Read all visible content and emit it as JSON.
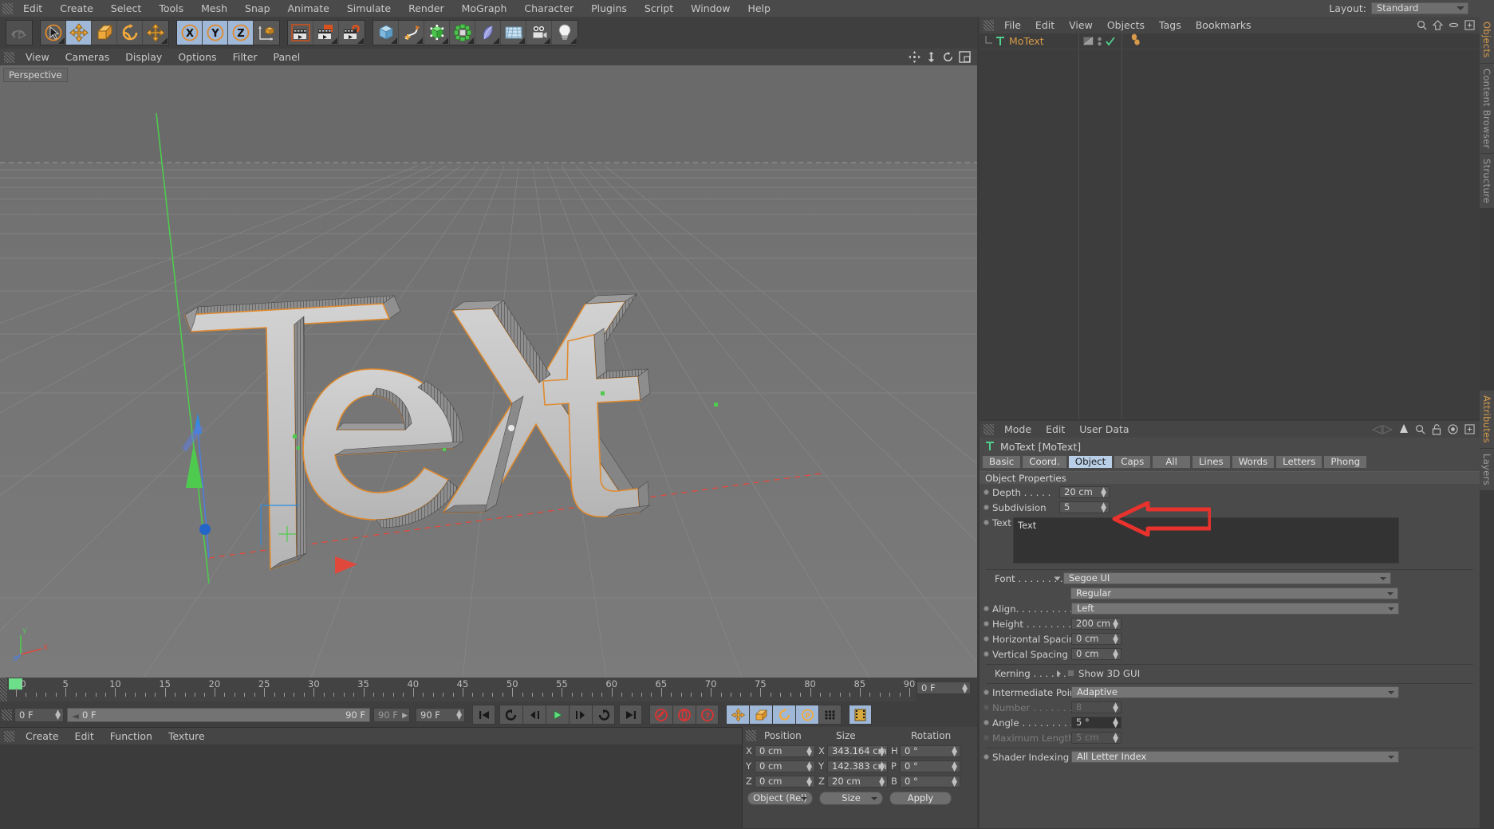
{
  "app": {
    "menu": [
      "Edit",
      "Create",
      "Select",
      "Tools",
      "Mesh",
      "Snap",
      "Animate",
      "Simulate",
      "Render",
      "MoGraph",
      "Character",
      "Plugins",
      "Script",
      "Window",
      "Help"
    ],
    "layout_label": "Layout:",
    "layout_value": "Standard"
  },
  "toolbar": {
    "groups": [
      {
        "name": "undo",
        "buttons": [
          {
            "icon": "undo-redo-icon",
            "label": "Undo/Redo",
            "state": "disabled"
          }
        ]
      },
      {
        "name": "transform",
        "buttons": [
          {
            "icon": "live-selection-icon",
            "label": "Live Selection",
            "state": "normal"
          },
          {
            "icon": "move-icon",
            "label": "Move",
            "state": "selected"
          },
          {
            "icon": "scale-icon",
            "label": "Scale",
            "state": "normal"
          },
          {
            "icon": "rotate-icon",
            "label": "Rotate",
            "state": "normal"
          },
          {
            "icon": "move-alt-icon",
            "label": "Move Tool",
            "state": "normal"
          }
        ]
      },
      {
        "name": "axis-lock",
        "buttons": [
          {
            "icon": "x-axis-icon",
            "label": "X Axis",
            "state": "selected"
          },
          {
            "icon": "y-axis-icon",
            "label": "Y Axis",
            "state": "selected"
          },
          {
            "icon": "z-axis-icon",
            "label": "Z Axis",
            "state": "selected"
          },
          {
            "icon": "world-object-axis-icon",
            "label": "World/Object Coordinate",
            "state": "normal"
          }
        ]
      },
      {
        "name": "render",
        "buttons": [
          {
            "icon": "render-view-icon",
            "label": "Render View",
            "state": "normal"
          },
          {
            "icon": "render-region-icon",
            "label": "Render to Picture Viewer",
            "state": "normal"
          },
          {
            "icon": "render-settings-icon",
            "label": "Edit Render Settings",
            "state": "normal"
          }
        ]
      },
      {
        "name": "objects",
        "buttons": [
          {
            "icon": "cube-primitive-icon",
            "label": "Add Cube Object",
            "state": "normal"
          },
          {
            "icon": "spline-pen-icon",
            "label": "Add Spline",
            "state": "normal"
          },
          {
            "icon": "generator-icon",
            "label": "Generators",
            "state": "normal"
          },
          {
            "icon": "array-icon",
            "label": "Modeling Objects",
            "state": "normal"
          },
          {
            "icon": "deformer-icon",
            "label": "Deformers",
            "state": "normal"
          },
          {
            "icon": "scene-environment-icon",
            "label": "Scene Objects",
            "state": "normal"
          },
          {
            "icon": "camera-icon",
            "label": "Add Camera",
            "state": "normal"
          },
          {
            "icon": "light-icon",
            "label": "Add Light",
            "state": "normal"
          }
        ]
      }
    ]
  },
  "viewport": {
    "menu": [
      "View",
      "Cameras",
      "Display",
      "Options",
      "Filter",
      "Panel"
    ],
    "view_label": "Perspective",
    "corner_icons": [
      "pan-icon",
      "dolly-icon",
      "rotate-view-icon",
      "maximize-view-icon"
    ],
    "axis_gizmo": {
      "y": "Y",
      "x": "X",
      "z": "Z"
    },
    "scene_text": "Text"
  },
  "timeline": {
    "ticks": [
      {
        "label": "0",
        "frame": 0
      },
      {
        "label": "5",
        "frame": 5
      },
      {
        "label": "10",
        "frame": 10
      },
      {
        "label": "15",
        "frame": 15
      },
      {
        "label": "20",
        "frame": 20
      },
      {
        "label": "25",
        "frame": 25
      },
      {
        "label": "30",
        "frame": 30
      },
      {
        "label": "35",
        "frame": 35
      },
      {
        "label": "40",
        "frame": 40
      },
      {
        "label": "45",
        "frame": 45
      },
      {
        "label": "50",
        "frame": 50
      },
      {
        "label": "55",
        "frame": 55
      },
      {
        "label": "60",
        "frame": 60
      },
      {
        "label": "65",
        "frame": 65
      },
      {
        "label": "70",
        "frame": 70
      },
      {
        "label": "75",
        "frame": 75
      },
      {
        "label": "80",
        "frame": 80
      },
      {
        "label": "85",
        "frame": 85
      },
      {
        "label": "90",
        "frame": 90
      }
    ],
    "range_min": 0,
    "range_max": 90,
    "current_frame_field": "0 F",
    "start_frame": "0 F",
    "slider_start": "0 F",
    "slider_end": "90 F",
    "end_frame_small": "90 F",
    "end_frame_field": "90 F",
    "transport_buttons": [
      {
        "icon": "go-to-start-icon",
        "label": "Go to Start"
      },
      {
        "icon": "step-back-keyframe-icon",
        "label": "Go to Previous Key"
      },
      {
        "icon": "step-back-icon",
        "label": "Go to Previous Frame"
      },
      {
        "icon": "play-icon",
        "label": "Play Forwards"
      },
      {
        "icon": "step-forward-icon",
        "label": "Go to Next Frame"
      },
      {
        "icon": "step-forward-keyframe-icon",
        "label": "Go to Next Key"
      },
      {
        "icon": "go-to-end-icon",
        "label": "Go to End"
      }
    ],
    "record_buttons": [
      {
        "icon": "record-key-icon",
        "label": "Record Active Objects"
      },
      {
        "icon": "autokey-icon",
        "label": "Autokeying"
      },
      {
        "icon": "keyframe-selection-icon",
        "label": "Keyframe Selection"
      }
    ],
    "key_toggles": [
      {
        "icon": "position-key-icon",
        "label": "Position",
        "state": "selected"
      },
      {
        "icon": "scale-key-icon",
        "label": "Scale",
        "state": "selected"
      },
      {
        "icon": "rotation-key-icon",
        "label": "Rotation",
        "state": "selected"
      },
      {
        "icon": "param-key-icon",
        "label": "Parameter",
        "state": "selected"
      },
      {
        "icon": "point-level-key-icon",
        "label": "Point Level Animation",
        "state": "normal"
      }
    ],
    "extra_buttons": [
      {
        "icon": "filmstrip-icon",
        "label": "Animation Mode",
        "state": "selected"
      }
    ]
  },
  "material_manager": {
    "menu": [
      "Create",
      "Edit",
      "Function",
      "Texture"
    ]
  },
  "coordinates": {
    "headers": [
      "Position",
      "Size",
      "Rotation"
    ],
    "rows": [
      {
        "pos_axis": "X",
        "pos": "0 cm",
        "size_axis": "X",
        "size": "343.164 cm",
        "rot_axis": "H",
        "rot": "0 °"
      },
      {
        "pos_axis": "Y",
        "pos": "0 cm",
        "size_axis": "Y",
        "size": "142.383 cm",
        "rot_axis": "P",
        "rot": "0 °"
      },
      {
        "pos_axis": "Z",
        "pos": "0 cm",
        "size_axis": "Z",
        "size": "20 cm",
        "rot_axis": "B",
        "rot": "0 °"
      }
    ],
    "mode_dropdown": "Object (Rel)",
    "size_dropdown": "Size",
    "apply_button": "Apply"
  },
  "object_manager": {
    "menu": [
      "File",
      "Edit",
      "View",
      "Objects",
      "Tags",
      "Bookmarks"
    ],
    "icons": [
      "search-icon",
      "home-icon",
      "ellipse-icon",
      "add-panel-icon"
    ],
    "items": [
      {
        "name": "MoText",
        "type_icon": "text-object-icon",
        "tags": [
          "mograph-tag-icon"
        ],
        "visible_dots": "on"
      }
    ]
  },
  "attributes": {
    "menu": [
      "Mode",
      "Edit",
      "User Data"
    ],
    "icons": [
      "nav-arrows-icon",
      "pin-icon",
      "search-icon",
      "lock-icon",
      "target-icon",
      "add-panel-icon"
    ],
    "object_title": "MoText [MoText]",
    "tabs": [
      {
        "label": "Basic",
        "active": false
      },
      {
        "label": "Coord.",
        "active": false
      },
      {
        "label": "Object",
        "active": true
      },
      {
        "label": "Caps",
        "active": false
      },
      {
        "label": "All",
        "active": false
      },
      {
        "label": "Lines",
        "active": false
      },
      {
        "label": "Words",
        "active": false
      },
      {
        "label": "Letters",
        "active": false
      },
      {
        "label": "Phong",
        "active": false
      }
    ],
    "section_title": "Object Properties",
    "fields": {
      "depth_label": "Depth . . . . .",
      "depth_value": "20 cm",
      "subdivision_label": "Subdivision",
      "subdivision_value": "5",
      "text_label": "Text",
      "text_value": "Text",
      "font_label": "Font . . . . . . . . . .",
      "font_value": "Segoe UI",
      "font_style_value": "Regular",
      "align_label": "Align. . . . . . . . . . .",
      "align_value": "Left",
      "height_label": "Height . . . . . . . . .",
      "height_value": "200 cm",
      "hspacing_label": "Horizontal Spacing",
      "hspacing_value": "0 cm",
      "vspacing_label": "Vertical Spacing . .",
      "vspacing_value": "0 cm",
      "kerning_label": "Kerning . . . . . . .",
      "show3dgui_label": "Show 3D GUI",
      "intermediate_label": "Intermediate Points",
      "intermediate_value": "Adaptive",
      "number_label": "Number . . . . . . . . .",
      "number_value": "8",
      "angle_label": "Angle . . . . . . . . . .",
      "angle_value": "5 °",
      "maxlen_label": "Maximum Length .",
      "maxlen_value": "5 cm",
      "shader_label": "Shader Indexing . .",
      "shader_value": "All Letter Index"
    }
  },
  "right_tabs": {
    "top": [
      {
        "label": "Objects",
        "active": true
      },
      {
        "label": "Content Browser",
        "active": false
      },
      {
        "label": "Structure",
        "active": false
      }
    ],
    "bottom": [
      {
        "label": "Attributes",
        "active": true
      },
      {
        "label": "Layers",
        "active": false
      }
    ]
  },
  "annotation": {
    "arrow_color": "#e8322d",
    "points_at": "subdivision-field"
  },
  "colors": {
    "accent_orange": "#d79b4a",
    "selected_blue": "#b9cfe8",
    "panel_bg": "#4a4a4a",
    "window_bg": "#3b3b3b"
  }
}
